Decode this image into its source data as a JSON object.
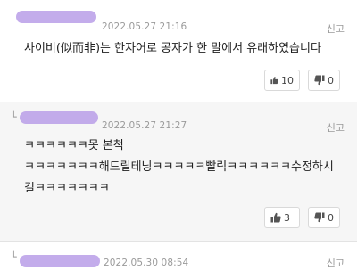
{
  "comments": [
    {
      "date": "2022.05.27 21:16",
      "report": "신고",
      "lines": [
        "사이비(似而非)는 한자어로 공자가 한 말에서 유래하였습니다"
      ],
      "likes": "10",
      "dislikes": "0"
    },
    {
      "reply_arrow": "└",
      "date": "2022.05.27 21:27",
      "report": "신고",
      "lines": [
        "ㅋㅋㅋㅋㅋㅋ못 본척",
        "ㅋㅋㅋㅋㅋㅋㅋ해드릴테닝ㅋㅋㅋㅋㅋ빨릭ㅋㅋㅋㅋㅋㅋ수정하시",
        "길ㅋㅋㅋㅋㅋㅋㅋ"
      ],
      "likes": "3",
      "dislikes": "0"
    },
    {
      "reply_arrow": "└",
      "date": "2022.05.30 08:54",
      "report": "신고"
    }
  ],
  "colors": {
    "scribble": "#b99ee8",
    "reply_bg": "#f6f6f6"
  }
}
